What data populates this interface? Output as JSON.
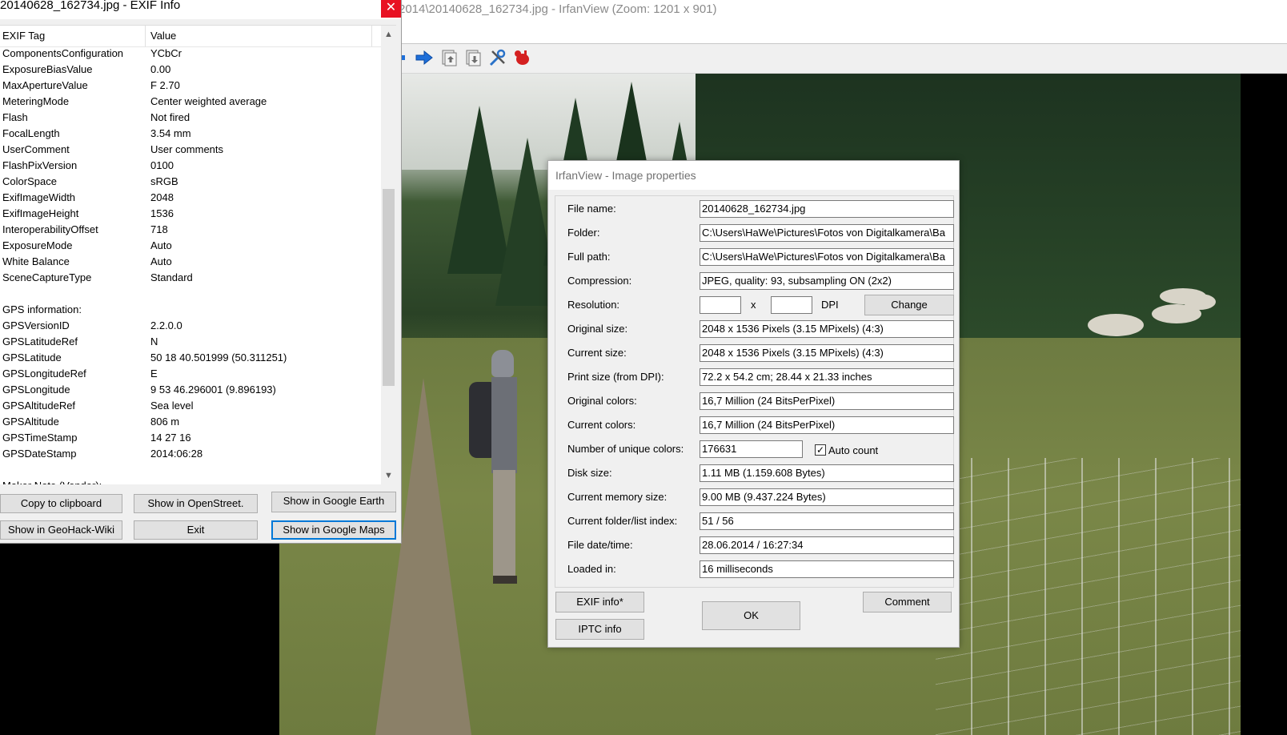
{
  "main_window": {
    "title": "2014\\20140628_162734.jpg - IrfanView (Zoom: 1201 x 901)"
  },
  "toolbar": {
    "icons": [
      "arrow-right-icon",
      "copy-up-icon",
      "copy-down-icon",
      "tools-icon",
      "exit-icon"
    ]
  },
  "exif_window": {
    "title": "20140628_162734.jpg - EXIF Info",
    "close_label": "✕",
    "columns": {
      "tag": "EXIF Tag",
      "value": "Value"
    },
    "rows": [
      {
        "tag": "ComponentsConfiguration",
        "value": "YCbCr"
      },
      {
        "tag": "ExposureBiasValue",
        "value": "0.00"
      },
      {
        "tag": "MaxApertureValue",
        "value": "F 2.70"
      },
      {
        "tag": "MeteringMode",
        "value": "Center weighted average"
      },
      {
        "tag": "Flash",
        "value": "Not fired"
      },
      {
        "tag": "FocalLength",
        "value": "3.54 mm"
      },
      {
        "tag": "UserComment",
        "value": "User comments"
      },
      {
        "tag": "FlashPixVersion",
        "value": "0100"
      },
      {
        "tag": "ColorSpace",
        "value": "sRGB"
      },
      {
        "tag": "ExifImageWidth",
        "value": "2048"
      },
      {
        "tag": "ExifImageHeight",
        "value": "1536"
      },
      {
        "tag": "InteroperabilityOffset",
        "value": "718"
      },
      {
        "tag": "ExposureMode",
        "value": "Auto"
      },
      {
        "tag": "White Balance",
        "value": "Auto"
      },
      {
        "tag": "SceneCaptureType",
        "value": "Standard"
      },
      {
        "tag": "",
        "value": ""
      },
      {
        "tag": "GPS information:",
        "value": ""
      },
      {
        "tag": "GPSVersionID",
        "value": "2.2.0.0"
      },
      {
        "tag": "GPSLatitudeRef",
        "value": "N"
      },
      {
        "tag": "GPSLatitude",
        "value": "50  18  40.501999 (50.311251)"
      },
      {
        "tag": "GPSLongitudeRef",
        "value": "E"
      },
      {
        "tag": "GPSLongitude",
        "value": "9  53  46.296001 (9.896193)"
      },
      {
        "tag": "GPSAltitudeRef",
        "value": "Sea level"
      },
      {
        "tag": "GPSAltitude",
        "value": "806 m"
      },
      {
        "tag": "GPSTimeStamp",
        "value": "14  27  16"
      },
      {
        "tag": "GPSDateStamp",
        "value": "2014:06:28"
      },
      {
        "tag": "",
        "value": ""
      },
      {
        "tag": "Maker Note (Vendor):",
        "value": ""
      }
    ],
    "buttons": {
      "copy": "Copy to clipboard",
      "openstreet": "Show in OpenStreet.",
      "google_earth": "Show in Google Earth",
      "geohack": "Show in GeoHack-Wiki",
      "exit": "Exit",
      "google_maps": "Show in Google Maps"
    }
  },
  "properties_dialog": {
    "title": "IrfanView - Image properties",
    "fields": {
      "file_name": {
        "label": "File name:",
        "value": "20140628_162734.jpg"
      },
      "folder": {
        "label": "Folder:",
        "value": "C:\\Users\\HaWe\\Pictures\\Fotos von Digitalkamera\\Ba"
      },
      "full_path": {
        "label": "Full path:",
        "value": "C:\\Users\\HaWe\\Pictures\\Fotos von Digitalkamera\\Ba"
      },
      "compression": {
        "label": "Compression:",
        "value": "JPEG, quality: 93, subsampling ON (2x2)"
      },
      "resolution": {
        "label": "Resolution:",
        "x_label": "x",
        "unit": "DPI",
        "button": "Change"
      },
      "original_size": {
        "label": "Original size:",
        "value": "2048 x 1536  Pixels (3.15 MPixels) (4:3)"
      },
      "current_size": {
        "label": "Current size:",
        "value": "2048 x 1536  Pixels (3.15 MPixels) (4:3)"
      },
      "print_size": {
        "label": "Print size (from DPI):",
        "value": "72.2 x 54.2 cm; 28.44 x 21.33 inches"
      },
      "original_colors": {
        "label": "Original colors:",
        "value": "16,7 Million   (24 BitsPerPixel)"
      },
      "current_colors": {
        "label": "Current colors:",
        "value": "16,7 Million   (24 BitsPerPixel)"
      },
      "unique_colors": {
        "label": "Number of unique colors:",
        "value": "176631",
        "checkbox_label": "Auto count",
        "checked": true
      },
      "disk_size": {
        "label": "Disk size:",
        "value": "1.11 MB (1.159.608 Bytes)"
      },
      "memory_size": {
        "label": "Current memory size:",
        "value": "9.00  MB (9.437.224 Bytes)"
      },
      "folder_index": {
        "label": "Current folder/list index:",
        "value": "51  /  56"
      },
      "file_date": {
        "label": "File date/time:",
        "value": "28.06.2014 / 16:27:34"
      },
      "loaded_in": {
        "label": "Loaded in:",
        "value": "16 milliseconds"
      }
    },
    "buttons": {
      "exif": "EXIF info*",
      "iptc": "IPTC info",
      "ok": "OK",
      "comment": "Comment"
    }
  },
  "colors": {
    "close_red": "#e81123",
    "focus_blue": "#0078d7"
  }
}
